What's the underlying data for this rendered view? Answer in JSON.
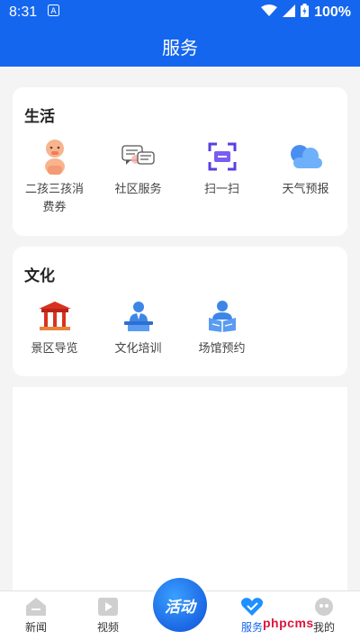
{
  "status_bar": {
    "time": "8:31",
    "battery": "100%"
  },
  "header": {
    "title": "服务"
  },
  "life": {
    "title": "生活",
    "items": [
      {
        "label": "二孩三孩消费券",
        "icon": "baby-icon"
      },
      {
        "label": "社区服务",
        "icon": "chat-icon"
      },
      {
        "label": "扫一扫",
        "icon": "scan-icon"
      },
      {
        "label": "天气预报",
        "icon": "cloud-icon"
      }
    ]
  },
  "culture": {
    "title": "文化",
    "items": [
      {
        "label": "景区导览",
        "icon": "pavilion-icon"
      },
      {
        "label": "文化培训",
        "icon": "lecturer-icon"
      },
      {
        "label": "场馆预约",
        "icon": "reader-icon"
      }
    ]
  },
  "tabbar": {
    "news": "新闻",
    "video": "视频",
    "activity": "活动",
    "service": "服务",
    "mine": "我的"
  },
  "watermark": "phpcms",
  "colors": {
    "brand": "#1566ee",
    "active_tab": "#1566ee",
    "watermark": "#e0143c"
  }
}
